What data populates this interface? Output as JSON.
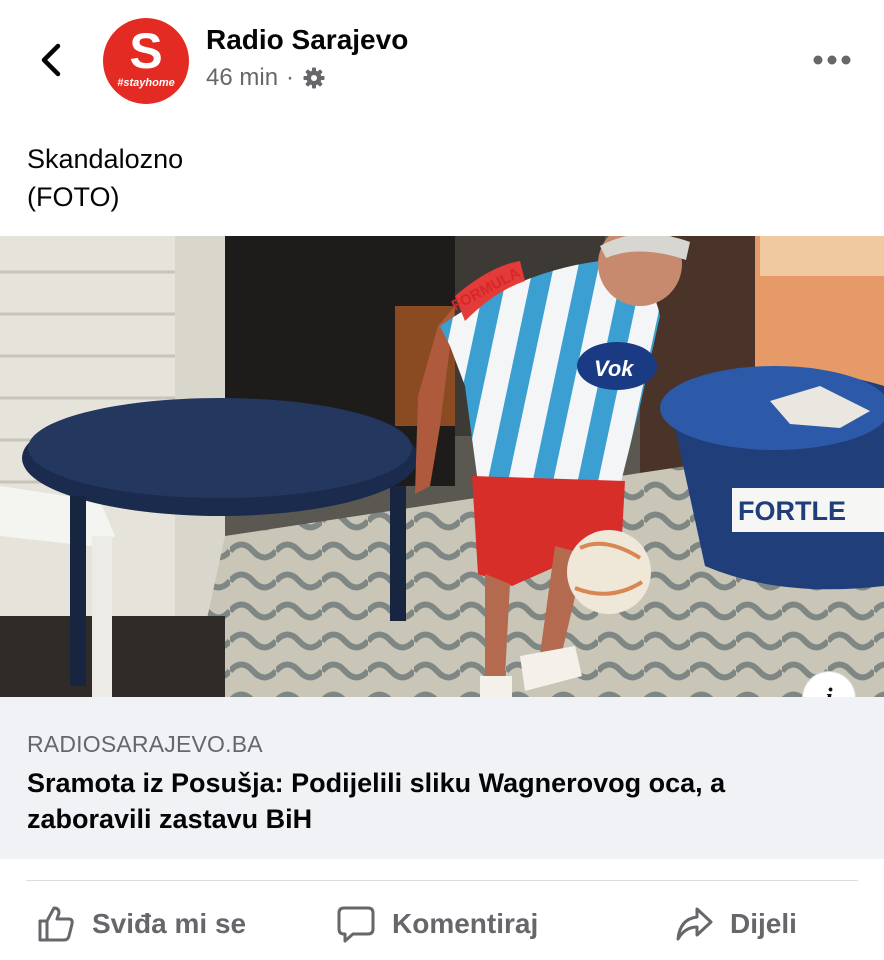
{
  "post": {
    "page_name": "Radio Sarajevo",
    "time": "46 min",
    "separator": "·",
    "audience_icon": "gear-icon",
    "avatar": {
      "letter": "S",
      "tagline": "#stayhome",
      "color": "#e42b23"
    },
    "text_lines": [
      "Skandalozno",
      "(FOTO)"
    ]
  },
  "link_preview": {
    "domain": "RADIOSARAJEVO.BA",
    "title": "Sramota iz Posušja: Podijelili sliku Wagnerovog oca, a zaboravili zastavu BiH",
    "info_label": "i"
  },
  "image_text": {
    "bucket_label": "FORTLE",
    "shirt_sponsor": "Vok",
    "shirt_brand": "FORMULA"
  },
  "actions": {
    "like": "Sviđa mi se",
    "comment": "Komentiraj",
    "share": "Dijeli"
  }
}
